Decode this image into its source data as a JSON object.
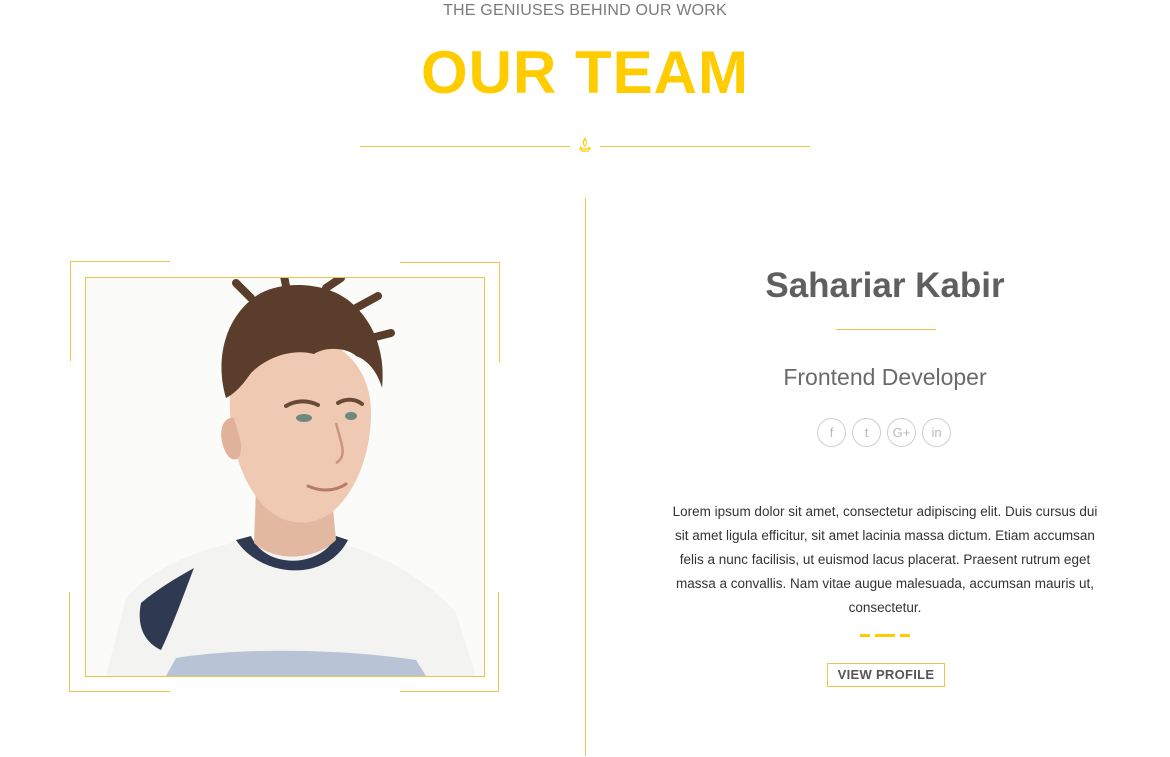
{
  "section": {
    "subheading": "THE GENIUSES BEHIND OUR WORK",
    "heading": "OUR TEAM"
  },
  "member": {
    "name": "Sahariar Kabir",
    "role": "Frontend Developer",
    "bio": "Lorem ipsum dolor sit amet, consectetur adipiscing elit. Duis cursus dui sit amet ligula efficitur, sit amet lacinia massa dictum. Etiam accumsan felis a nunc facilisis, ut euismod lacus placerat. Praesent rutrum eget massa a convallis. Nam vitae augue malesuada, accumsan mauris ut, consectetur.",
    "button_label": "VIEW PROFILE",
    "socials": [
      {
        "icon": "facebook-icon",
        "glyph": "f"
      },
      {
        "icon": "twitter-icon",
        "glyph": "t"
      },
      {
        "icon": "google-plus-icon",
        "glyph": "G+"
      },
      {
        "icon": "linkedin-icon",
        "glyph": "in"
      }
    ]
  },
  "colors": {
    "accent": "#ffcc00",
    "line": "#e8c84a",
    "text": "#5f5f5f"
  }
}
